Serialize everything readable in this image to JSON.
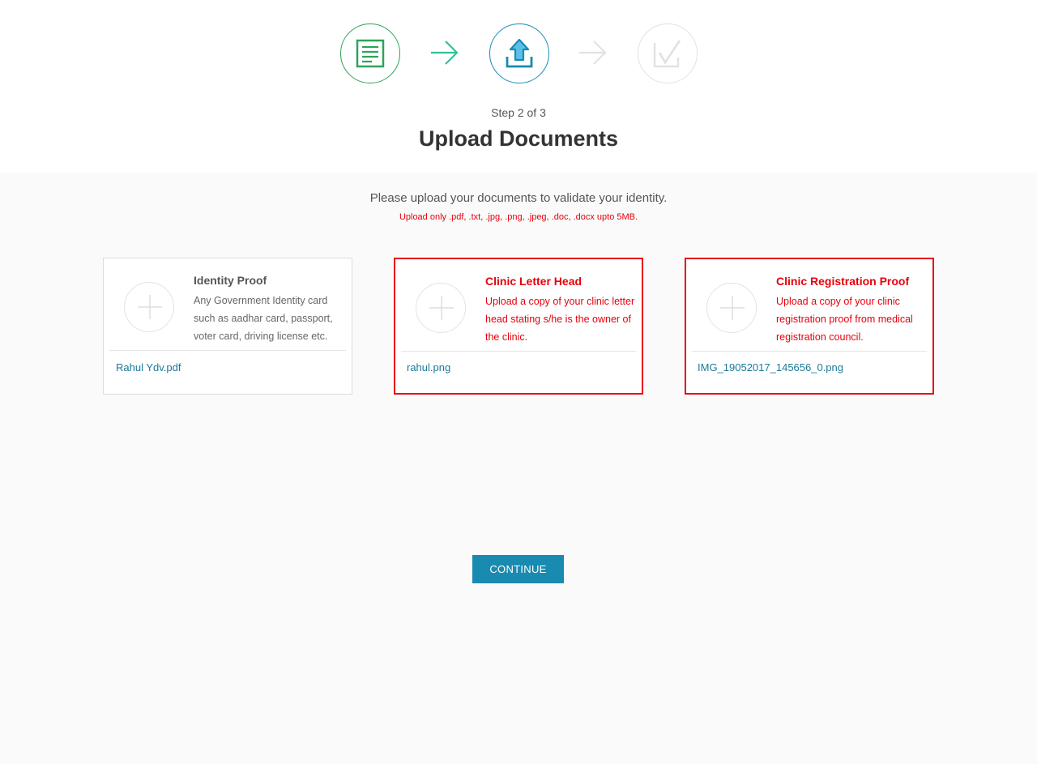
{
  "stepper": {
    "step_label": "Step 2 of 3",
    "title": "Upload Documents",
    "steps": [
      {
        "icon": "document-form-icon",
        "state": "complete",
        "color": "#2fa35a"
      },
      {
        "icon": "upload-icon",
        "state": "active",
        "color": "#1a8bb0"
      },
      {
        "icon": "checkmark-icon",
        "state": "pending",
        "color": "#e2e2e2"
      }
    ],
    "arrow_colors": [
      "#2fc19b",
      "#e2e2e2"
    ]
  },
  "intro": {
    "text": "Please upload your documents to validate your identity.",
    "note": "Upload only .pdf, .txt, .jpg, .png, .jpeg, .doc, .docx upto 5MB."
  },
  "cards": [
    {
      "title": "Identity Proof",
      "description": "Any Government Identity card such as aadhar card, passport, voter card, driving license etc.",
      "file_name": "Rahul Ydv.pdf",
      "state": "normal"
    },
    {
      "title": "Clinic Letter Head",
      "description": "Upload a copy of your clinic letter head stating s/he is the owner of the clinic.",
      "file_name": "rahul.png",
      "state": "error"
    },
    {
      "title": "Clinic Registration Proof",
      "description": "Upload a copy of your clinic registration proof from medical registration council.",
      "file_name": "IMG_19052017_145656_0.png",
      "state": "error"
    }
  ],
  "actions": {
    "continue_label": "CONTINUE"
  },
  "colors": {
    "accent": "#1a8bb0",
    "success": "#2fa35a",
    "error": "#e8000b",
    "link": "#1a7a99"
  }
}
